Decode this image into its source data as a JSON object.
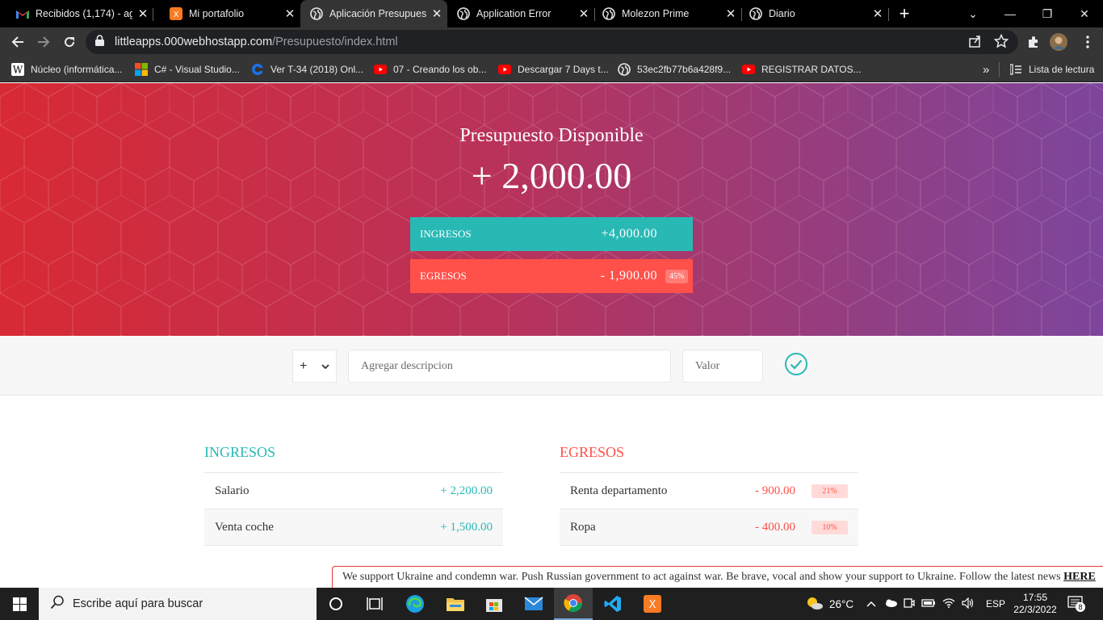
{
  "browser": {
    "tabs": [
      {
        "title": "Recibidos (1,174) - ag",
        "icon": "gmail-icon"
      },
      {
        "title": "Mi portafolio",
        "icon": "xampp-icon"
      },
      {
        "title": "Aplicación Presupuest",
        "icon": "globe-icon",
        "active": true
      },
      {
        "title": "Application Error",
        "icon": "globe-icon"
      },
      {
        "title": "Molezon Prime",
        "icon": "globe-icon"
      },
      {
        "title": "Diario",
        "icon": "globe-icon"
      }
    ],
    "url_host": "littleapps.000webhostapp.com",
    "url_path": "/Presupuesto/index.html",
    "bookmarks": [
      {
        "label": "Núcleo (informática..."
      },
      {
        "label": "C# - Visual Studio..."
      },
      {
        "label": "Ver T-34 (2018) Onl..."
      },
      {
        "label": "07 - Creando los ob..."
      },
      {
        "label": "Descargar 7 Days t..."
      },
      {
        "label": "53ec2fb77b6a428f9..."
      },
      {
        "label": "REGISTRAR DATOS..."
      }
    ],
    "reading_list": "Lista de lectura",
    "overflow": "»"
  },
  "app": {
    "title": "Presupuesto Disponible",
    "available": "+ 2,000.00",
    "income_summary": {
      "label": "INGRESOS",
      "value": "+4,000.00"
    },
    "expense_summary": {
      "label": "EGRESOS",
      "value": "- 1,900.00",
      "percent": "45%"
    },
    "add": {
      "type_selected": "+",
      "description_placeholder": "Agregar descripcion",
      "value_placeholder": "Valor"
    },
    "income_list": {
      "title": "INGRESOS",
      "items": [
        {
          "description": "Salario",
          "value": "+ 2,200.00"
        },
        {
          "description": "Venta coche",
          "value": "+ 1,500.00"
        }
      ]
    },
    "expense_list": {
      "title": "EGRESOS",
      "items": [
        {
          "description": "Renta departamento",
          "value": "- 900.00",
          "percent": "21%"
        },
        {
          "description": "Ropa",
          "value": "- 400.00",
          "percent": "10%"
        }
      ]
    },
    "banner": {
      "text": "We support Ukraine and condemn war. Push Russian government to act against war. Be brave, vocal and show your support to Ukraine. Follow the latest news ",
      "link": "HERE"
    }
  },
  "taskbar": {
    "search_placeholder": "Escribe aquí para buscar",
    "temperature": "26°C",
    "language": "ESP",
    "time": "17:55",
    "date": "22/3/2022",
    "notifications": "8"
  },
  "colors": {
    "income": "#28b9b5",
    "expense": "#ff5049",
    "gradient_start": "#d82a34",
    "gradient_end": "#7d459c"
  }
}
